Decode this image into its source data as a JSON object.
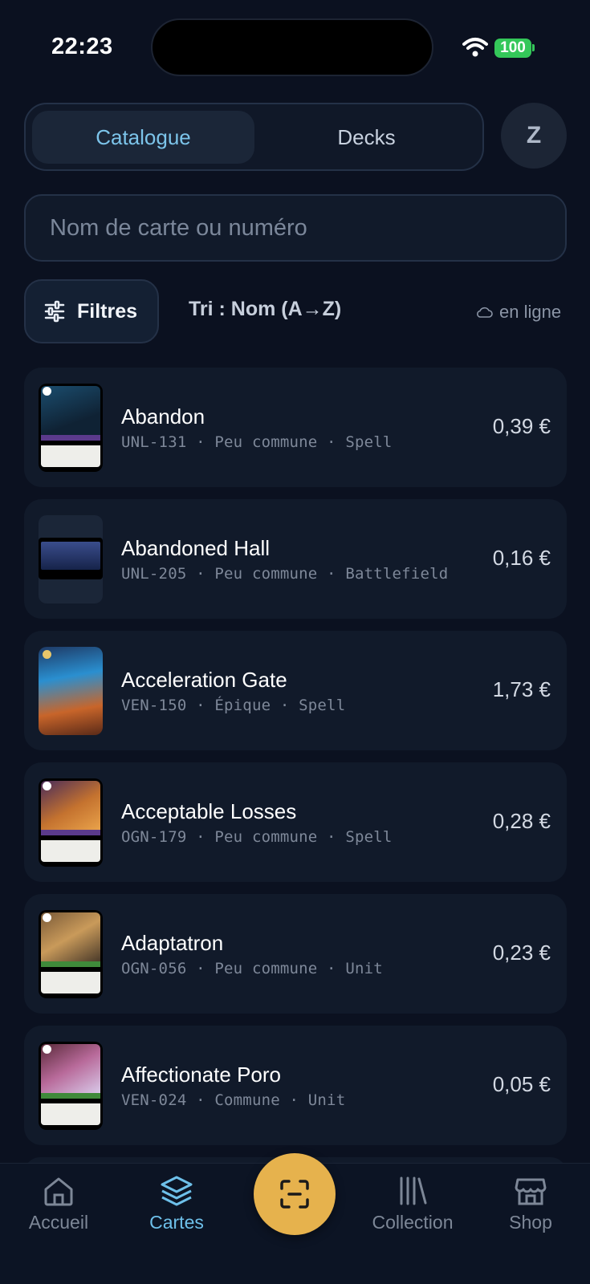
{
  "status": {
    "time": "22:23",
    "battery": "100"
  },
  "tabs_top": {
    "catalogue": "Catalogue",
    "decks": "Decks",
    "avatar": "Z"
  },
  "search": {
    "placeholder": "Nom de carte ou numéro"
  },
  "toolbar": {
    "filters": "Filtres",
    "sort": "Tri : Nom (A→Z)",
    "online": "en ligne"
  },
  "cards": [
    {
      "name": "Abandon",
      "meta": "UNL-131 · Peu commune · Spell",
      "price": "0,39 €"
    },
    {
      "name": "Abandoned Hall",
      "meta": "UNL-205 · Peu commune · Battlefield",
      "price": "0,16 €"
    },
    {
      "name": "Acceleration Gate",
      "meta": "VEN-150 · Épique · Spell",
      "price": "1,73 €"
    },
    {
      "name": "Acceptable Losses",
      "meta": "OGN-179 · Peu commune · Spell",
      "price": "0,28 €"
    },
    {
      "name": "Adaptatron",
      "meta": "OGN-056 · Peu commune · Unit",
      "price": "0,23 €"
    },
    {
      "name": "Affectionate Poro",
      "meta": "VEN-024 · Commune · Unit",
      "price": "0,05 €"
    }
  ],
  "nav": {
    "home": "Accueil",
    "cards": "Cartes",
    "collection": "Collection",
    "shop": "Shop"
  },
  "colors": {
    "accent": "#6ec0ea",
    "scan": "#e6b24d",
    "background": "#0b1120",
    "online_badge": "#34c759"
  }
}
